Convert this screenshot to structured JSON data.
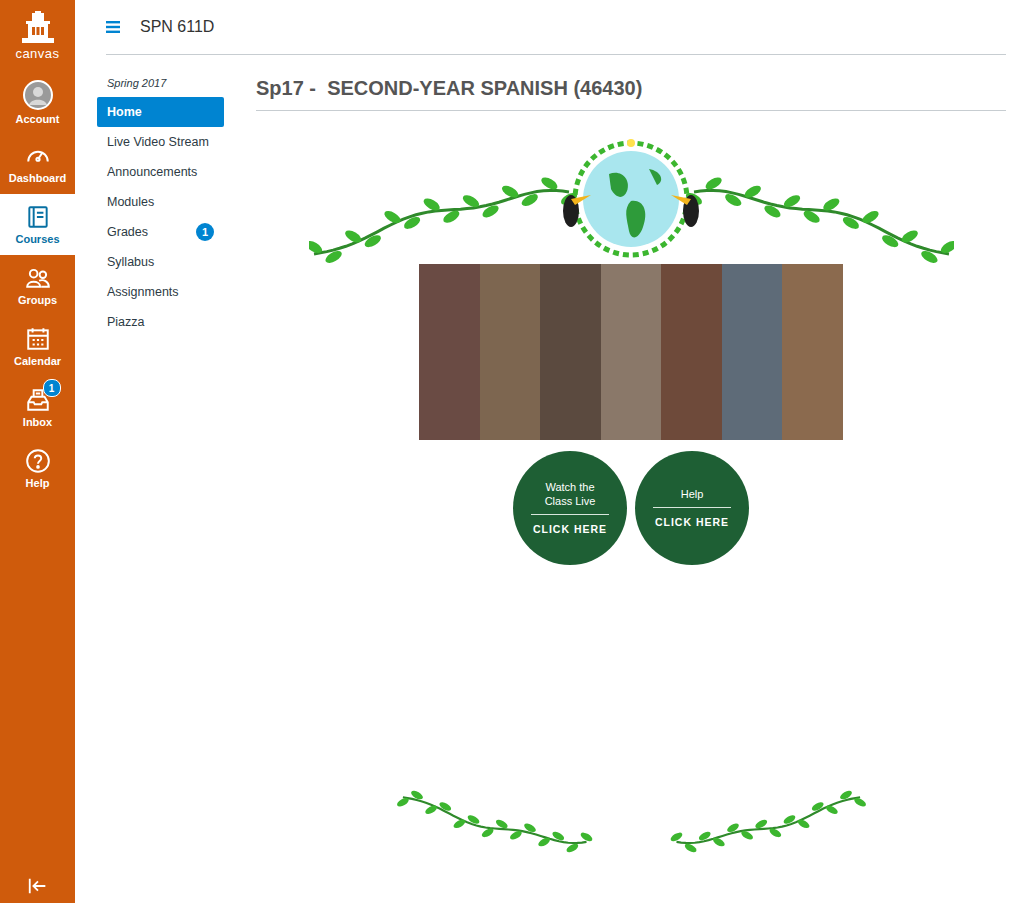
{
  "global_nav": {
    "logo": "canvas",
    "items": [
      {
        "label": "Account",
        "selected": false
      },
      {
        "label": "Dashboard",
        "selected": false
      },
      {
        "label": "Courses",
        "selected": true
      },
      {
        "label": "Groups",
        "selected": false
      },
      {
        "label": "Calendar",
        "selected": false
      },
      {
        "label": "Inbox",
        "selected": false,
        "badge": "1"
      },
      {
        "label": "Help",
        "selected": false
      }
    ]
  },
  "header": {
    "course_code": "SPN 611D"
  },
  "course_nav": {
    "term": "Spring 2017",
    "items": [
      {
        "label": "Home",
        "selected": true
      },
      {
        "label": "Live Video Stream",
        "selected": false
      },
      {
        "label": "Announcements",
        "selected": false
      },
      {
        "label": "Modules",
        "selected": false
      },
      {
        "label": "Grades",
        "selected": false,
        "badge": "1"
      },
      {
        "label": "Syllabus",
        "selected": false
      },
      {
        "label": "Assignments",
        "selected": false
      },
      {
        "label": "Piazza",
        "selected": false
      }
    ]
  },
  "page": {
    "title": "Sp17 -  SECOND-YEAR SPANISH (46430)",
    "buttons": [
      {
        "label": "Watch the Class Live",
        "action": "CLICK HERE"
      },
      {
        "label": "Help",
        "action": "CLICK HERE"
      }
    ]
  }
}
